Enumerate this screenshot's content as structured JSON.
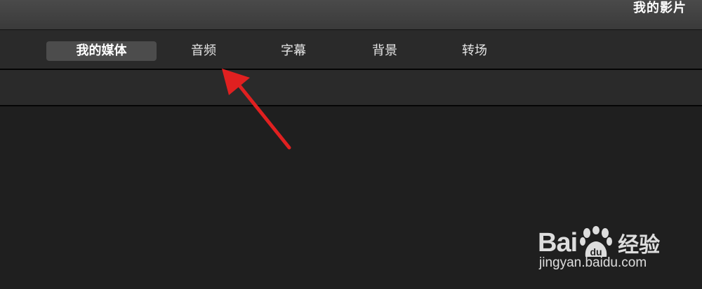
{
  "window": {
    "title": "我的影片"
  },
  "tabs": [
    {
      "label": "我的媒体",
      "active": true
    },
    {
      "label": "音频",
      "active": false
    },
    {
      "label": "字幕",
      "active": false
    },
    {
      "label": "背景",
      "active": false
    },
    {
      "label": "转场",
      "active": false
    }
  ],
  "annotation": {
    "icon": "red-arrow-icon",
    "color": "#e02020"
  },
  "watermark": {
    "brand_left": "Bai",
    "brand_paw": "du",
    "brand_cn": "经验",
    "url": "jingyan.baidu.com"
  },
  "colors": {
    "background": "#1f1f1f",
    "tab_bar": "#2a2a2a",
    "active_tab": "#4c4c4c",
    "text": "#e6e6e6"
  }
}
